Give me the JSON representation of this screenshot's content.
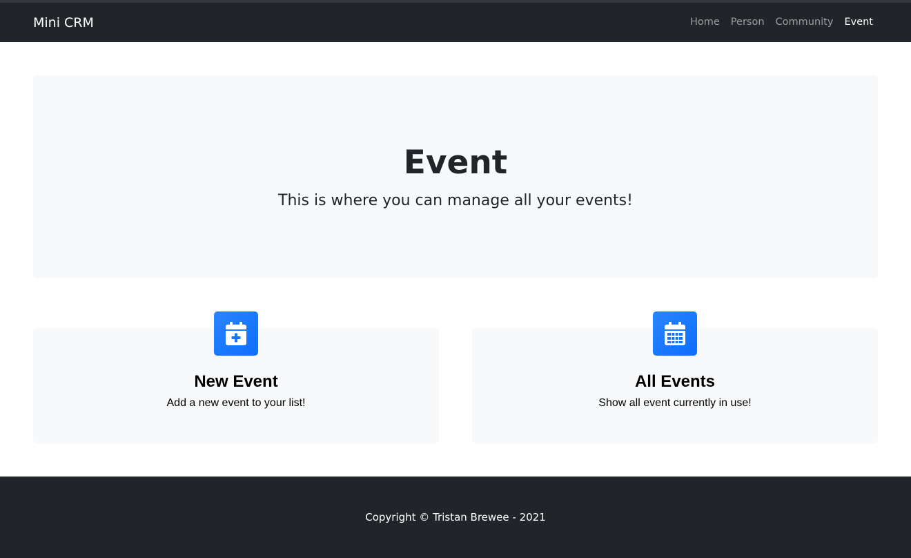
{
  "navbar": {
    "brand": "Mini CRM",
    "links": [
      {
        "label": "Home",
        "active": false
      },
      {
        "label": "Person",
        "active": false
      },
      {
        "label": "Community",
        "active": false
      },
      {
        "label": "Event",
        "active": true
      }
    ]
  },
  "hero": {
    "title": "Event",
    "subtitle": "This is where you can manage all your events!"
  },
  "cards": [
    {
      "icon": "calendar-plus-icon",
      "title": "New Event",
      "text": "Add a new event to your list!"
    },
    {
      "icon": "calendar-grid-icon",
      "title": "All Events",
      "text": "Show all event currently in use!"
    }
  ],
  "footer": {
    "text": "Copyright © Tristan Brewee - 2021"
  },
  "colors": {
    "navbar_bg": "#212529",
    "accent": "#0d6efd",
    "panel_bg": "#f8f9fa"
  }
}
